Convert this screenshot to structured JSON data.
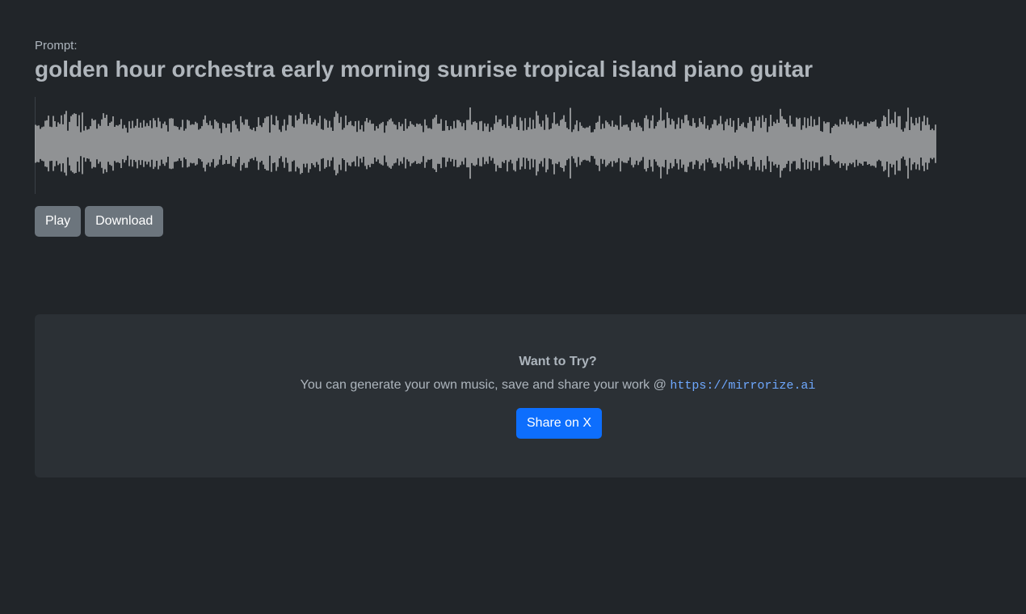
{
  "prompt": {
    "label": "Prompt:",
    "text": "golden hour orchestra early morning sunrise tropical island piano guitar"
  },
  "player": {
    "play_label": "Play",
    "download_label": "Download",
    "waveform_color": "#ffffff"
  },
  "try_card": {
    "title": "Want to Try?",
    "text": "You can generate your own music, save and share your work @ ",
    "link_text": "https://mirrorize.ai",
    "share_label": "Share on X",
    "share_color": "#0d6efd"
  }
}
